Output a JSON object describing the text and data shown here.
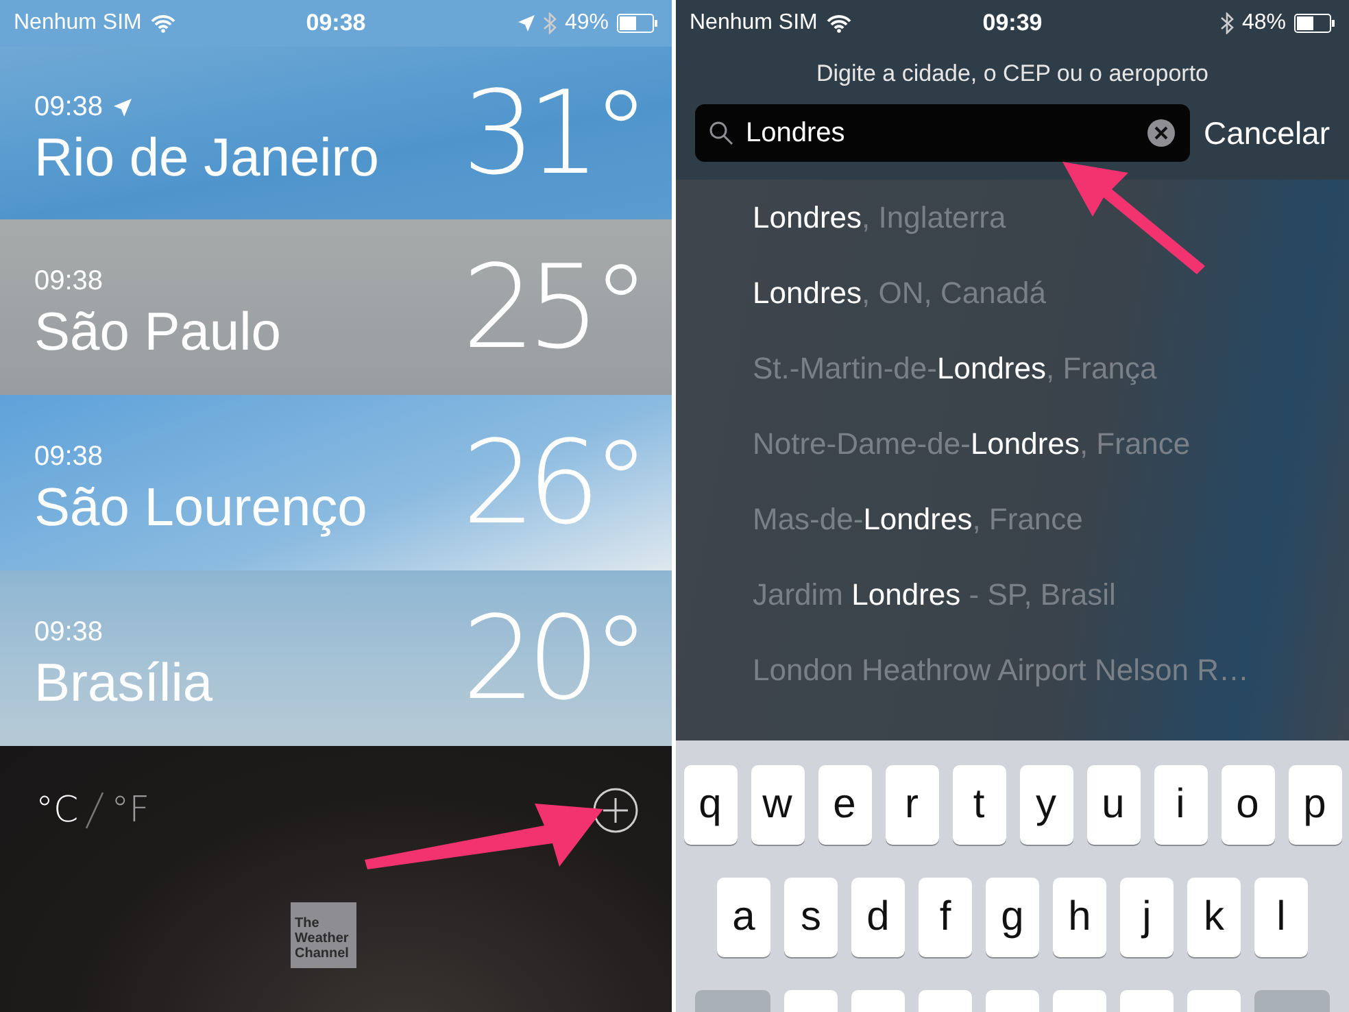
{
  "weather_list_screen": {
    "status_bar": {
      "carrier": "Nenhum SIM",
      "time": "09:38",
      "battery": "49%",
      "location_active": true
    },
    "cities": [
      {
        "time": "09:38",
        "current_location": true,
        "name": "Rio de Janeiro",
        "temperature": "31°"
      },
      {
        "time": "09:38",
        "current_location": false,
        "name": "São Paulo",
        "temperature": "25°"
      },
      {
        "time": "09:38",
        "current_location": false,
        "name": "São Lourenço",
        "temperature": "26°"
      },
      {
        "time": "09:38",
        "current_location": false,
        "name": "Brasília",
        "temperature": "20°"
      }
    ],
    "units": [
      {
        "label": "°C",
        "selected": true
      },
      {
        "label": "°F",
        "selected": false
      }
    ],
    "logo_text": "The Weather Channel"
  },
  "search_screen": {
    "status_bar": {
      "carrier": "Nenhum SIM",
      "time": "09:39",
      "battery": "48%",
      "location_active": false
    },
    "prompt": "Digite a cidade, o CEP ou o aeroporto",
    "search": {
      "value": "Londres"
    },
    "cancel": "Cancelar",
    "results": [
      [
        {
          "text": "Londres",
          "match": true
        },
        {
          "text": ", Inglaterra",
          "match": false
        }
      ],
      [
        {
          "text": "Londres",
          "match": true
        },
        {
          "text": ", ON, Canadá",
          "match": false
        }
      ],
      [
        {
          "text": "St.-Martin-de-",
          "match": false
        },
        {
          "text": "Londres",
          "match": true
        },
        {
          "text": ", França",
          "match": false
        }
      ],
      [
        {
          "text": "Notre-Dame-de-",
          "match": false
        },
        {
          "text": "Londres",
          "match": true
        },
        {
          "text": ", France",
          "match": false
        }
      ],
      [
        {
          "text": "Mas-de-",
          "match": false
        },
        {
          "text": "Londres",
          "match": true
        },
        {
          "text": ", France",
          "match": false
        }
      ],
      [
        {
          "text": "Jardim ",
          "match": false
        },
        {
          "text": "Londres",
          "match": true
        },
        {
          "text": " - SP, Brasil",
          "match": false
        }
      ],
      [
        {
          "text": "London Heathrow Airport Nelson R…",
          "match": false
        }
      ]
    ],
    "keyboard": {
      "rows": [
        [
          "q",
          "w",
          "e",
          "r",
          "t",
          "y",
          "u",
          "i",
          "o",
          "p"
        ],
        [
          "a",
          "s",
          "d",
          "f",
          "g",
          "h",
          "j",
          "k",
          "l"
        ]
      ]
    }
  }
}
